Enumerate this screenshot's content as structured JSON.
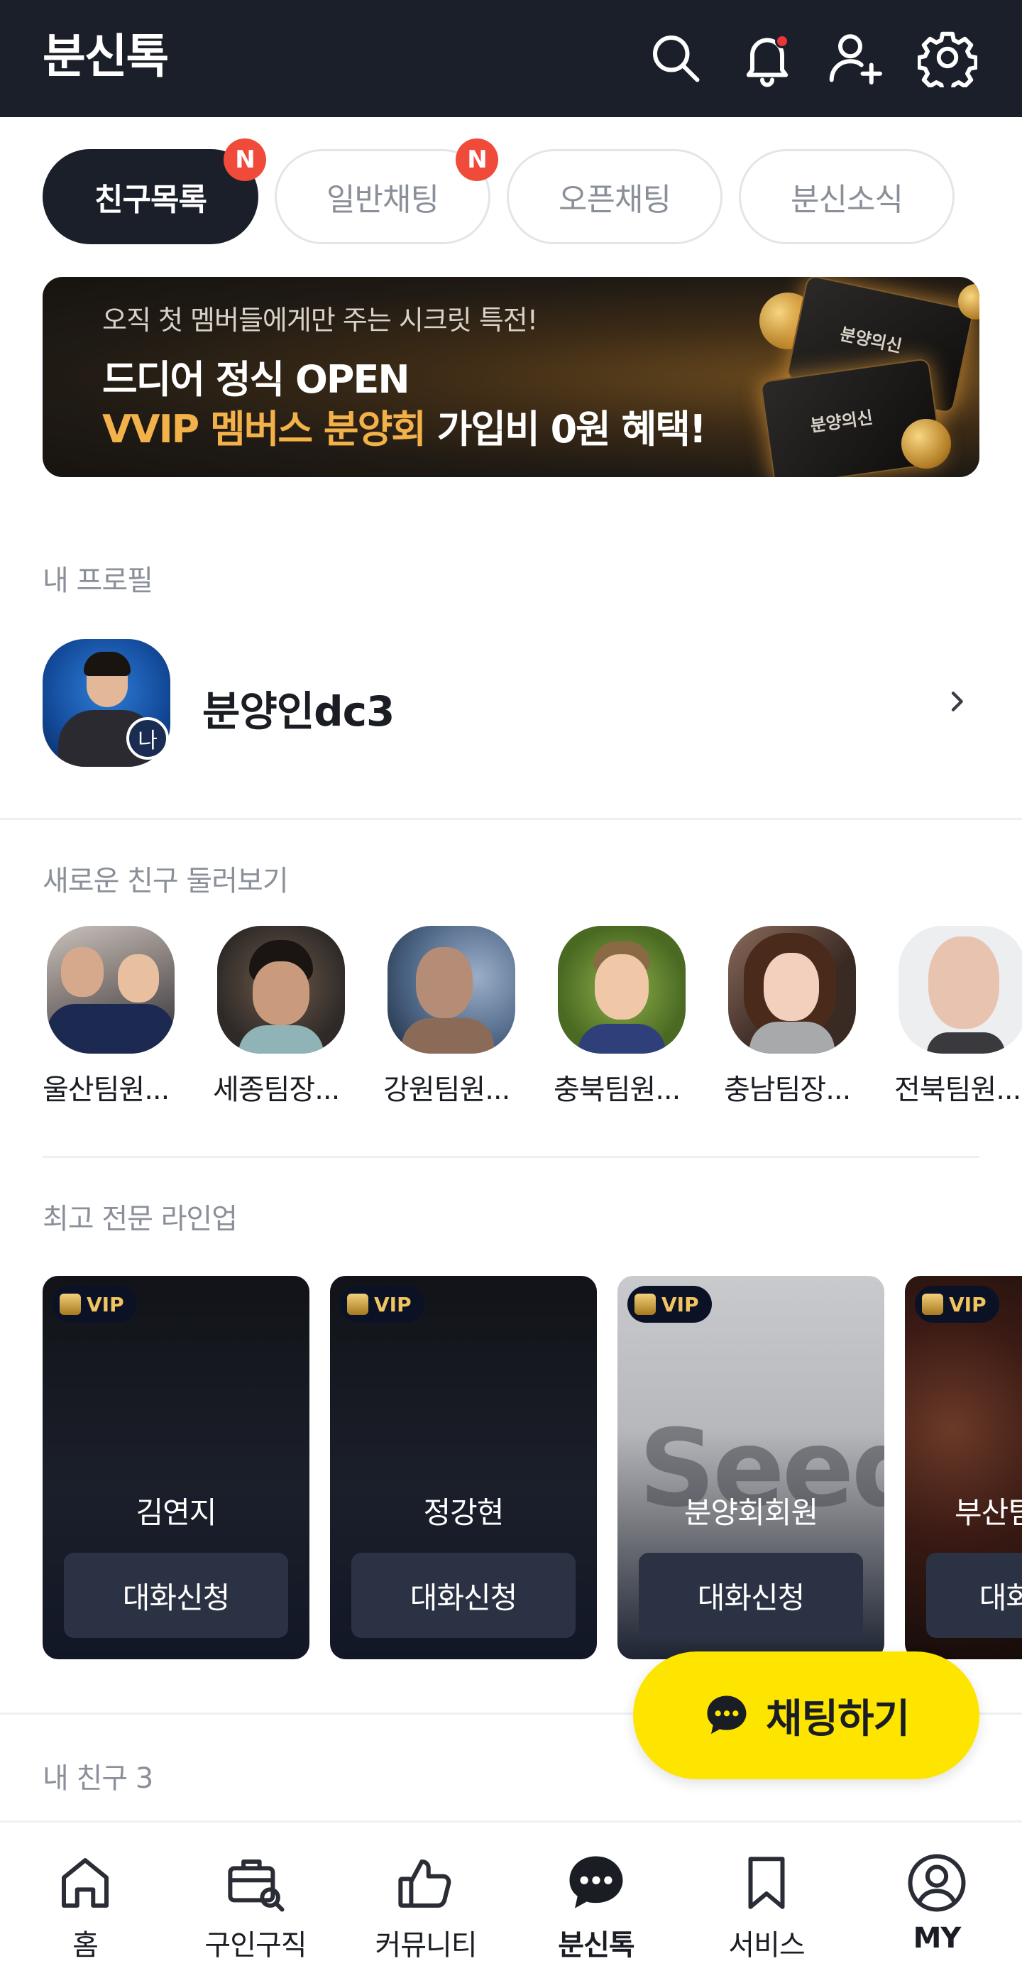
{
  "header": {
    "title": "분신톡",
    "icons": [
      "search-icon",
      "bell-icon",
      "add-friend-icon",
      "gear-icon"
    ]
  },
  "tabs": [
    {
      "label": "친구목록",
      "active": true,
      "badge": "N"
    },
    {
      "label": "일반채팅",
      "active": false,
      "badge": "N"
    },
    {
      "label": "오픈채팅",
      "active": false,
      "badge": ""
    },
    {
      "label": "분신소식",
      "active": false,
      "badge": ""
    }
  ],
  "banner": {
    "subtitle": "오직 첫 멤버들에게만 주는 시크릿 특전!",
    "line1": "드디어 정식 OPEN",
    "line2_gold": "VVIP 멤버스 분양회",
    "line2_rest": " 가입비 0원 혜택!",
    "card_text": "분양의신"
  },
  "my_profile": {
    "section_title": "내 프로필",
    "name": "분양인dc3",
    "me_badge": "나"
  },
  "new_friends": {
    "section_title": "새로운 친구 둘러보기",
    "items": [
      {
        "name": "울산팀원..."
      },
      {
        "name": "세종팀장..."
      },
      {
        "name": "강원팀원..."
      },
      {
        "name": "충북팀원..."
      },
      {
        "name": "충남팀장..."
      },
      {
        "name": "전북팀원..."
      }
    ]
  },
  "lineup": {
    "section_title": "최고 전문 라인업",
    "badge": "VIP",
    "button_label": "대화신청",
    "cards": [
      {
        "name": "김연지",
        "style": "dark"
      },
      {
        "name": "정강현",
        "style": "dark"
      },
      {
        "name": "분양회회원",
        "style": "light",
        "watermark": "Seed"
      },
      {
        "name": "부산팀",
        "style": "photo"
      }
    ]
  },
  "my_friends": {
    "section_title": "내 친구 3"
  },
  "chat_fab": {
    "label": "채팅하기"
  },
  "bottom_nav": [
    {
      "label": "홈",
      "icon": "home-icon",
      "active": false
    },
    {
      "label": "구인구직",
      "icon": "briefcase-search-icon",
      "active": false
    },
    {
      "label": "커뮤니티",
      "icon": "thumbs-up-icon",
      "active": false
    },
    {
      "label": "분신톡",
      "icon": "chat-bubble-icon",
      "active": true
    },
    {
      "label": "서비스",
      "icon": "bookmark-icon",
      "active": false
    },
    {
      "label": "MY",
      "icon": "user-circle-icon",
      "active": false
    }
  ],
  "colors": {
    "header_bg": "#1a1f29",
    "badge_red": "#f04a3b",
    "accent_gold": "#f3b14a",
    "fab_yellow": "#fde500"
  }
}
